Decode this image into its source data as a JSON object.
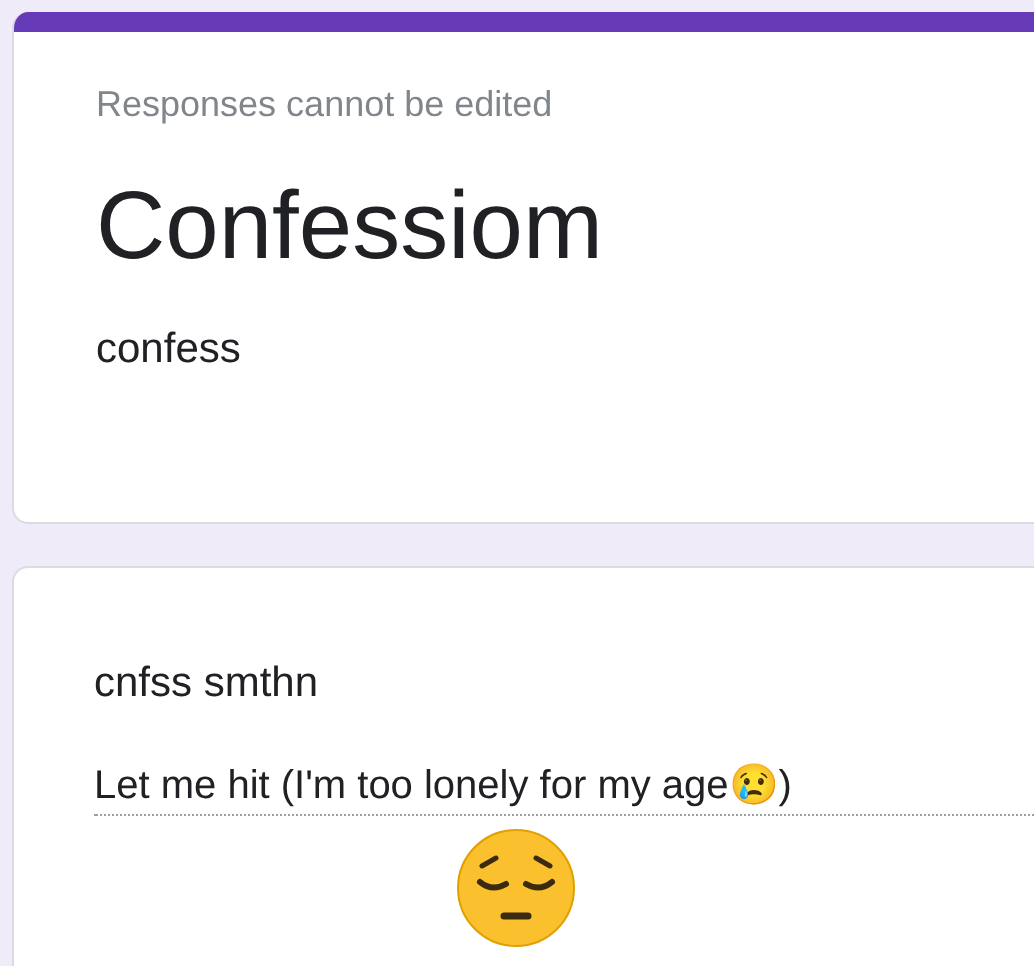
{
  "header_card": {
    "notice": "Responses cannot be edited",
    "title": "Confessiom",
    "description": "confess"
  },
  "question_card": {
    "question": "cnfss smthn",
    "answer": "Let me hit (I'm too lonely for my age😢)"
  }
}
